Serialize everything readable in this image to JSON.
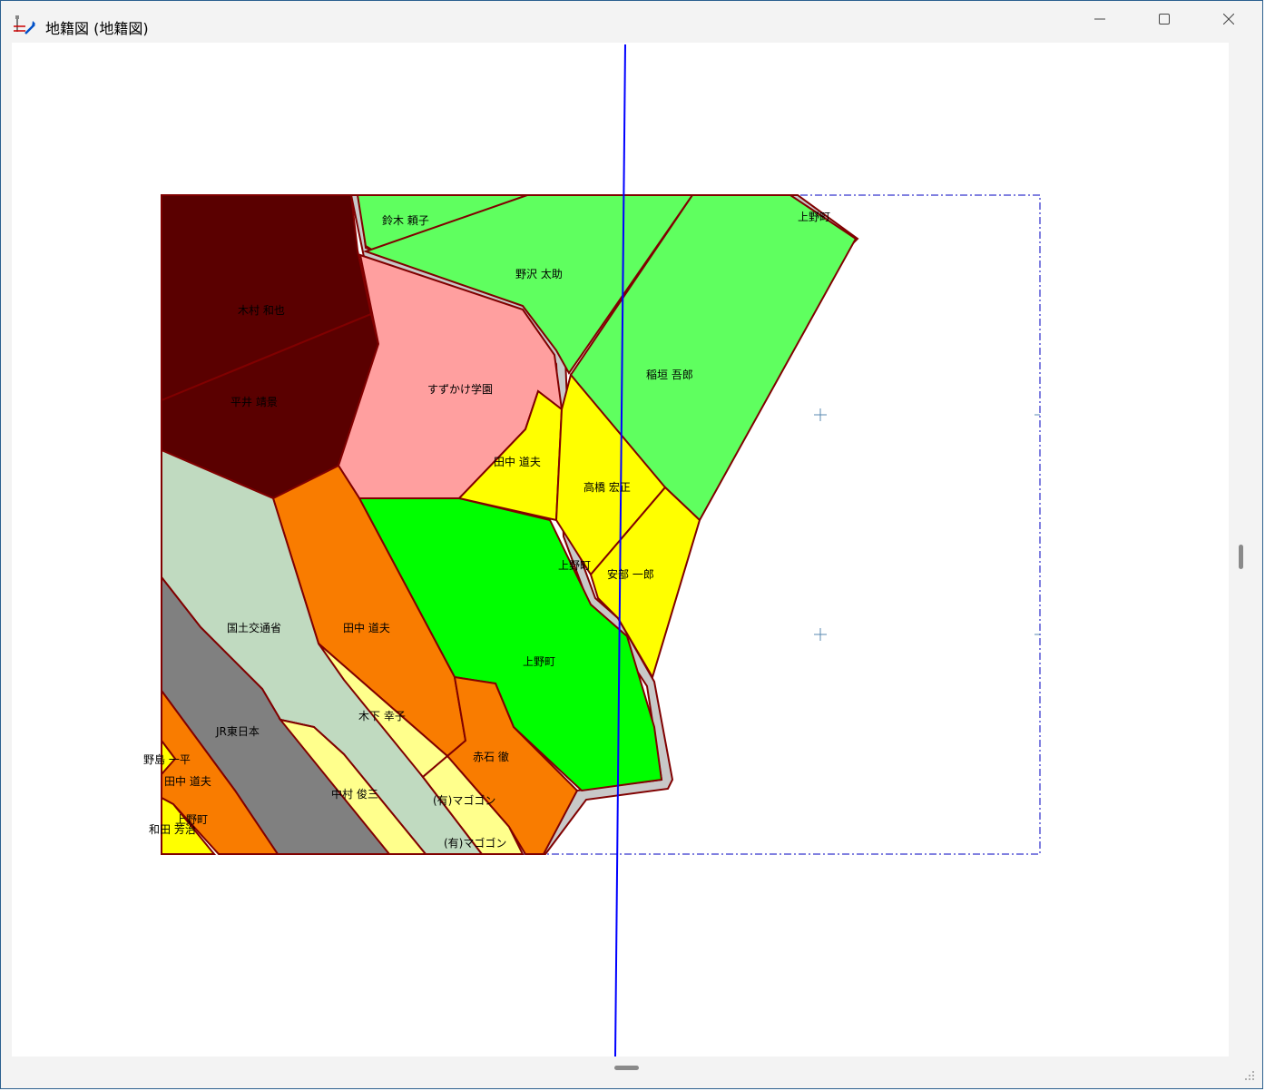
{
  "window": {
    "title": "地籍図 (地籍図)",
    "icon": "cadastral-map-app-icon",
    "controls": {
      "minimize": "minimize-icon",
      "maximize": "maximize-icon",
      "close": "close-icon"
    }
  },
  "map": {
    "colors": {
      "dark_parcel": "#5a0000",
      "light_green": "#5fff5f",
      "green": "#00ff00",
      "pink": "#ff9f9f",
      "yellow": "#ffff00",
      "light_yellow": "#ffff8c",
      "orange": "#f97c00",
      "sage": "#c0dac0",
      "gray": "#808080",
      "road": "#c8c8c8",
      "boundary": "#800000",
      "section_line": "#0000ff",
      "extent_line": "#0000c0"
    },
    "labels": {
      "suzuki": "鈴木 頼子",
      "ueno_top": "上野町",
      "nozawa": "野沢 太助",
      "kimura": "木村 和也",
      "inagaki": "稲垣 吾郎",
      "hirai": "平井 靖景",
      "suzukake": "すずかけ学園",
      "tanaka_michio_1": "田中 道夫",
      "takahashi": "高橋 宏正",
      "ueno_mid": "上野町",
      "abe": "安部 一郎",
      "kokudo": "国土交通省",
      "tanaka_michio_2": "田中 道夫",
      "ueno_green": "上野町",
      "kinoshita": "木下 幸子",
      "jr": "JR東日本",
      "akaishi": "赤石 徹",
      "nojima": "野島 一平",
      "tanaka_michio_3": "田中 道夫",
      "nakamura": "中村 俊三",
      "magogon_1": "(有)マゴゴン",
      "ueno_low": "上野町",
      "wada": "和田 芳治",
      "magogon_2": "(有)マゴゴン"
    }
  }
}
